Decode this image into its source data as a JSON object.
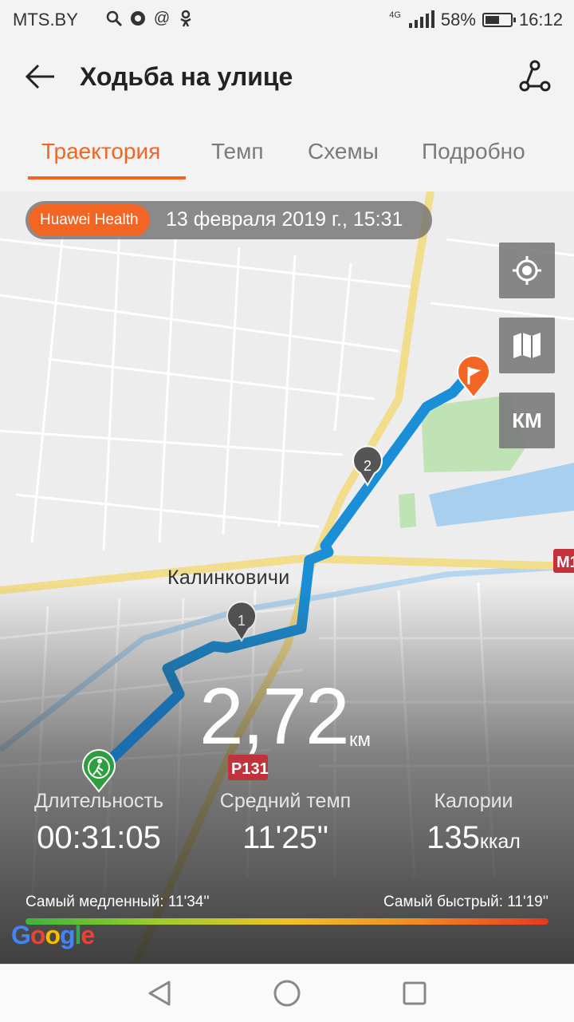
{
  "status_bar": {
    "carrier": "MTS.BY",
    "icons": [
      "search-icon",
      "chrome-icon",
      "at-icon",
      "ok-icon"
    ],
    "network": "4G",
    "battery": "58%",
    "battery_level": 0.58,
    "time": "16:12"
  },
  "header": {
    "title": "Ходьба на улице"
  },
  "tabs": [
    {
      "label": "Траектория",
      "active": true
    },
    {
      "label": "Темп",
      "active": false
    },
    {
      "label": "Схемы",
      "active": false
    },
    {
      "label": "Подробно",
      "active": false
    }
  ],
  "map": {
    "source_badge": "Huawei Health",
    "date": "13 февраля 2019 г., 15:31",
    "city_label": "Калинковичи",
    "road_labels": [
      "P131",
      "M1"
    ],
    "unit_toggle": "КМ",
    "km_markers": [
      "1",
      "2"
    ],
    "attribution": "Google"
  },
  "summary": {
    "distance": "2,72",
    "distance_unit": "км",
    "duration_label": "Длительность",
    "duration_value": "00:31:05",
    "pace_label": "Средний темп",
    "pace_value": "11'25\"",
    "calories_label": "Калории",
    "calories_value": "135",
    "calories_unit": "ккал",
    "slowest": "Самый медленный: 11'34''",
    "fastest": "Самый быстрый: 11'19''"
  },
  "colors": {
    "accent": "#f26522",
    "route": "#1a8fd8",
    "start_marker": "#2e9e3e"
  }
}
